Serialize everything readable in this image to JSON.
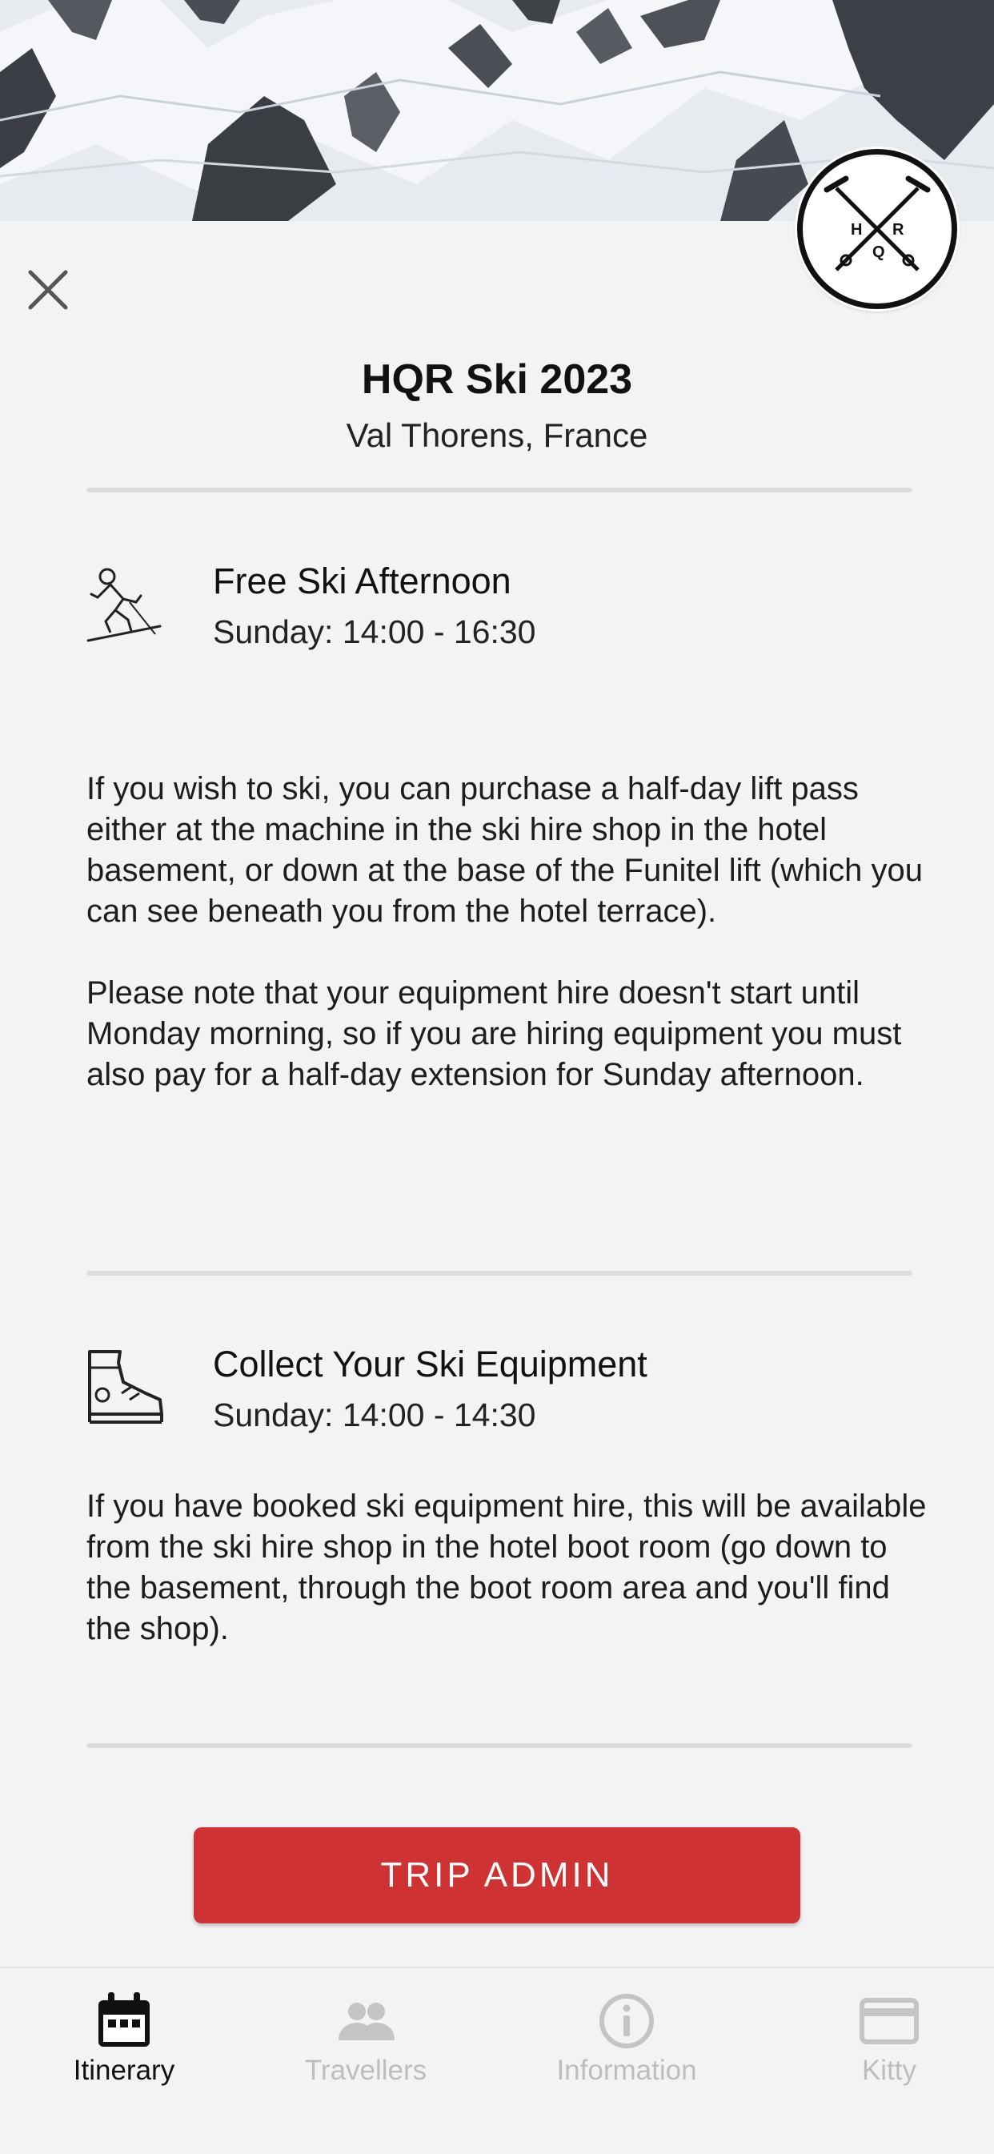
{
  "header": {
    "title": "HQR Ski 2023",
    "location": "Val Thorens, France",
    "logo_letters": [
      "H",
      "R",
      "Q"
    ],
    "close_icon": "close-icon"
  },
  "events": [
    {
      "icon": "skier-icon",
      "title": "Free Ski Afternoon",
      "time": "Sunday: 14:00 - 16:30",
      "paragraphs": [
        "If you wish to ski, you can purchase a half-day lift pass either at the machine in the ski hire shop in the hotel basement, or down at the base of the Funitel lift (which you can see beneath you from the hotel terrace).",
        "Please note that your equipment hire doesn't start until Monday morning, so if you are hiring equipment you must also pay for a half-day extension for Sunday afternoon."
      ]
    },
    {
      "icon": "ski-boot-icon",
      "title": "Collect Your Ski Equipment",
      "time": "Sunday: 14:00 - 14:30",
      "paragraphs": [
        "If you have booked ski equipment hire, this will be available from the ski hire shop in the hotel boot room (go down to the basement, through the boot room area and you'll find the shop)."
      ]
    }
  ],
  "admin_button": {
    "label": "TRIP ADMIN",
    "color": "#cf3232"
  },
  "tabbar": {
    "active_color": "#111111",
    "inactive_color": "#bdbdbf",
    "tabs": [
      {
        "label": "Itinerary",
        "icon": "calendar-icon",
        "active": true
      },
      {
        "label": "Travellers",
        "icon": "people-icon",
        "active": false
      },
      {
        "label": "Information",
        "icon": "info-icon",
        "active": false
      },
      {
        "label": "Kitty",
        "icon": "credit-card-icon",
        "active": false
      }
    ]
  }
}
